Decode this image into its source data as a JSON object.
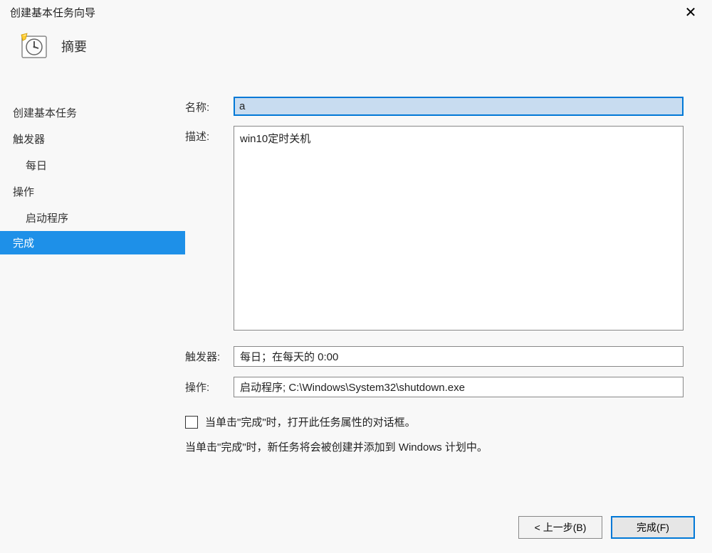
{
  "window": {
    "title": "创建基本任务向导"
  },
  "header": {
    "heading": "摘要"
  },
  "sidebar": {
    "items": [
      {
        "label": "创建基本任务",
        "type": "item"
      },
      {
        "label": "触发器",
        "type": "item"
      },
      {
        "label": "每日",
        "type": "subitem"
      },
      {
        "label": "操作",
        "type": "item"
      },
      {
        "label": "启动程序",
        "type": "subitem"
      },
      {
        "label": "完成",
        "type": "item",
        "active": true
      }
    ]
  },
  "form": {
    "name_label": "名称:",
    "name_value": "a",
    "desc_label": "描述:",
    "desc_value": "win10定时关机",
    "trigger_label": "触发器:",
    "trigger_value": "每日；在每天的 0:00",
    "action_label": "操作:",
    "action_value": "启动程序; C:\\Windows\\System32\\shutdown.exe",
    "checkbox_label": "当单击\"完成\"时，打开此任务属性的对话框。",
    "info_text": "当单击\"完成\"时，新任务将会被创建并添加到 Windows 计划中。"
  },
  "buttons": {
    "back": "< 上一步(B)",
    "finish": "完成(F)"
  }
}
